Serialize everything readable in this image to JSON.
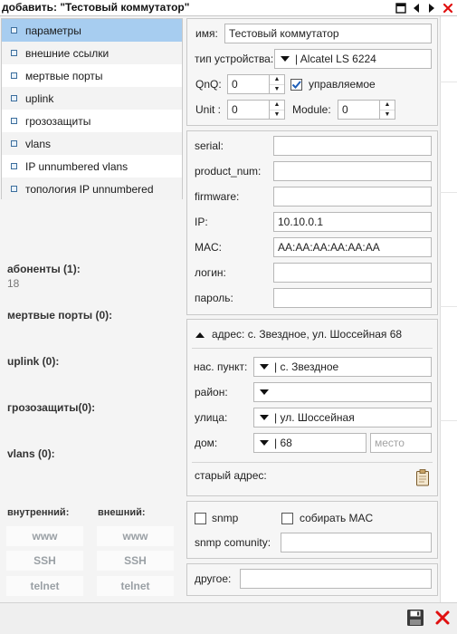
{
  "window": {
    "title": "добавить: \"Тестовый коммутатор\""
  },
  "menu": {
    "items": [
      {
        "label": "параметры",
        "active": true
      },
      {
        "label": "внешние ссылки"
      },
      {
        "label": "мертвые порты"
      },
      {
        "label": "uplink"
      },
      {
        "label": "грозозащиты"
      },
      {
        "label": "vlans"
      },
      {
        "label": "IP unnumbered vlans"
      },
      {
        "label": "топология IP unnumbered"
      }
    ]
  },
  "left": {
    "subscribers_label": "абоненты (1):",
    "subscribers_value": "18",
    "dead_ports": "мертвые порты (0):",
    "uplink": "uplink (0):",
    "lightning": "грозозащиты(0):",
    "vlans": "vlans (0):",
    "internal_label": "внутренний:",
    "external_label": "внешний:",
    "services": [
      "www",
      "SSH",
      "telnet"
    ]
  },
  "device": {
    "name_label": "имя:",
    "name_value": "Тестовый коммутатор",
    "type_label": "тип устройства:",
    "type_value": "| Alcatel LS 6224",
    "qnq_label": "QnQ:",
    "qnq_value": "0",
    "managed_label": "управляемое",
    "managed_checked": true,
    "unit_label": "Unit :",
    "unit_value": "0",
    "module_label": "Module:",
    "module_value": "0"
  },
  "details": {
    "fields": [
      {
        "label": "serial:",
        "value": ""
      },
      {
        "label": "product_num:",
        "value": ""
      },
      {
        "label": "firmware:",
        "value": ""
      },
      {
        "label": "IP:",
        "value": "10.10.0.1"
      },
      {
        "label": "MAC:",
        "value": "AA:AA:AA:AA:AA:AA"
      },
      {
        "label": "логин:",
        "value": ""
      },
      {
        "label": "пароль:",
        "value": ""
      }
    ]
  },
  "address": {
    "header": "адрес: с. Звездное, ул. Шоссейная 68",
    "settlement_label": "нас. пункт:",
    "settlement_value": "| с. Звездное",
    "district_label": "район:",
    "district_value": "",
    "street_label": "улица:",
    "street_value": "| ул. Шоссейная",
    "house_label": "дом:",
    "house_value": "| 68",
    "place_placeholder": "место",
    "old_address_label": "старый адрес:"
  },
  "snmp": {
    "snmp_label": "snmp",
    "collect_mac_label": "собирать MAC",
    "community_label": "snmp comunity:",
    "community_value": ""
  },
  "other": {
    "label": "другое:",
    "value": ""
  },
  "colors": {
    "menu_active": "#a7cdf0",
    "close_red": "#e01010",
    "panel_bg": "#f6f6f6"
  }
}
